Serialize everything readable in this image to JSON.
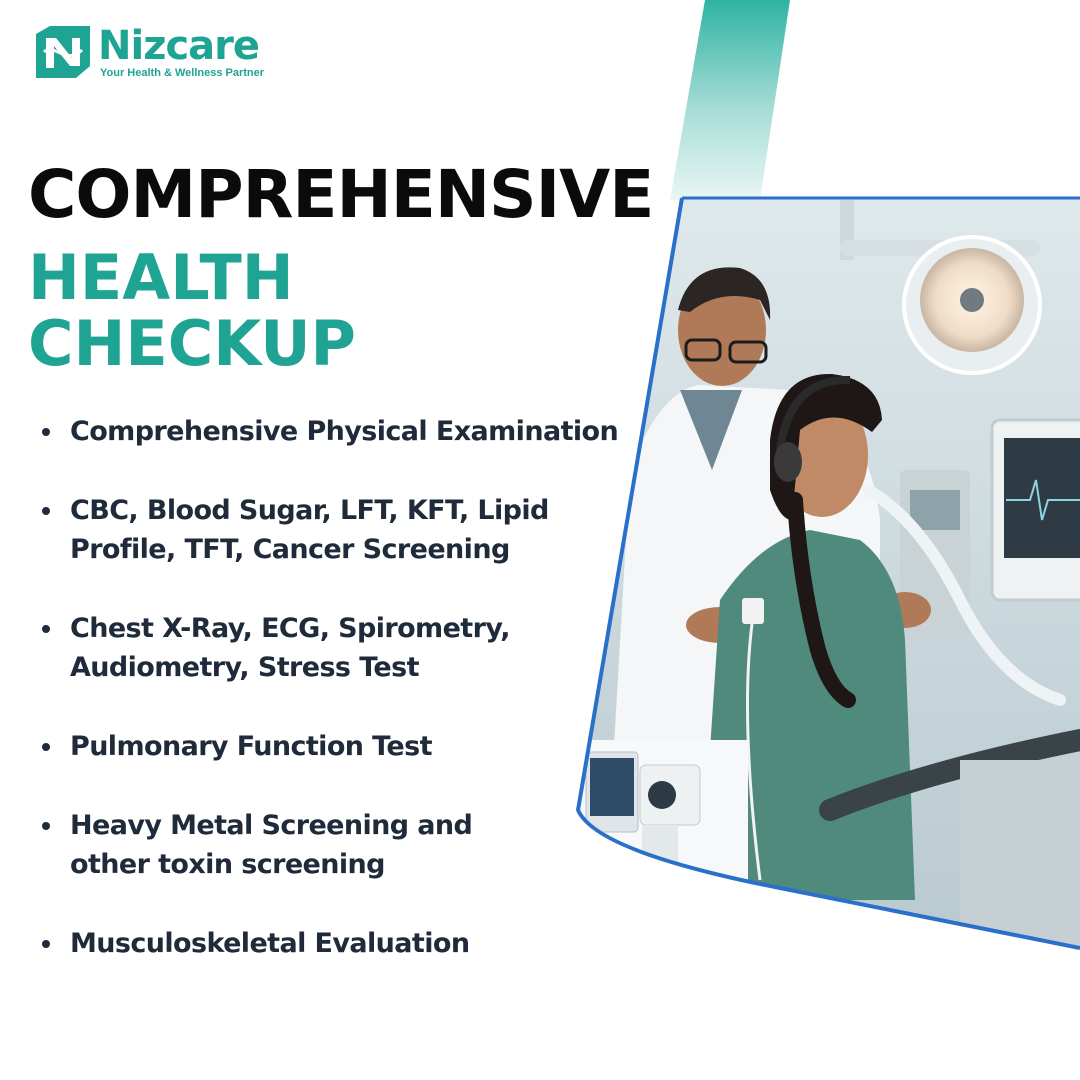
{
  "brand": {
    "name": "Nizcare",
    "tagline": "Your Health & Wellness Partner"
  },
  "heading": {
    "line1": "COMPREHENSIVE",
    "line2": "HEALTH",
    "line3": "CHECKUP"
  },
  "features": [
    "Comprehensive Physical Examination",
    "CBC, Blood Sugar, LFT, KFT, Lipid Profile, TFT, Cancer Screening",
    "Chest X-Ray, ECG, Spirometry, Audiometry, Stress Test",
    "Pulmonary Function Test",
    "Heavy Metal Screening and other toxin screening",
    "Musculoskeletal Evaluation"
  ],
  "colors": {
    "accent": "#1fa393",
    "heading_dark": "#0b0b0b",
    "body_text": "#1f2a3a",
    "frame_border": "#2a6fc9"
  },
  "icons": [
    "nizcare-logo-icon"
  ]
}
